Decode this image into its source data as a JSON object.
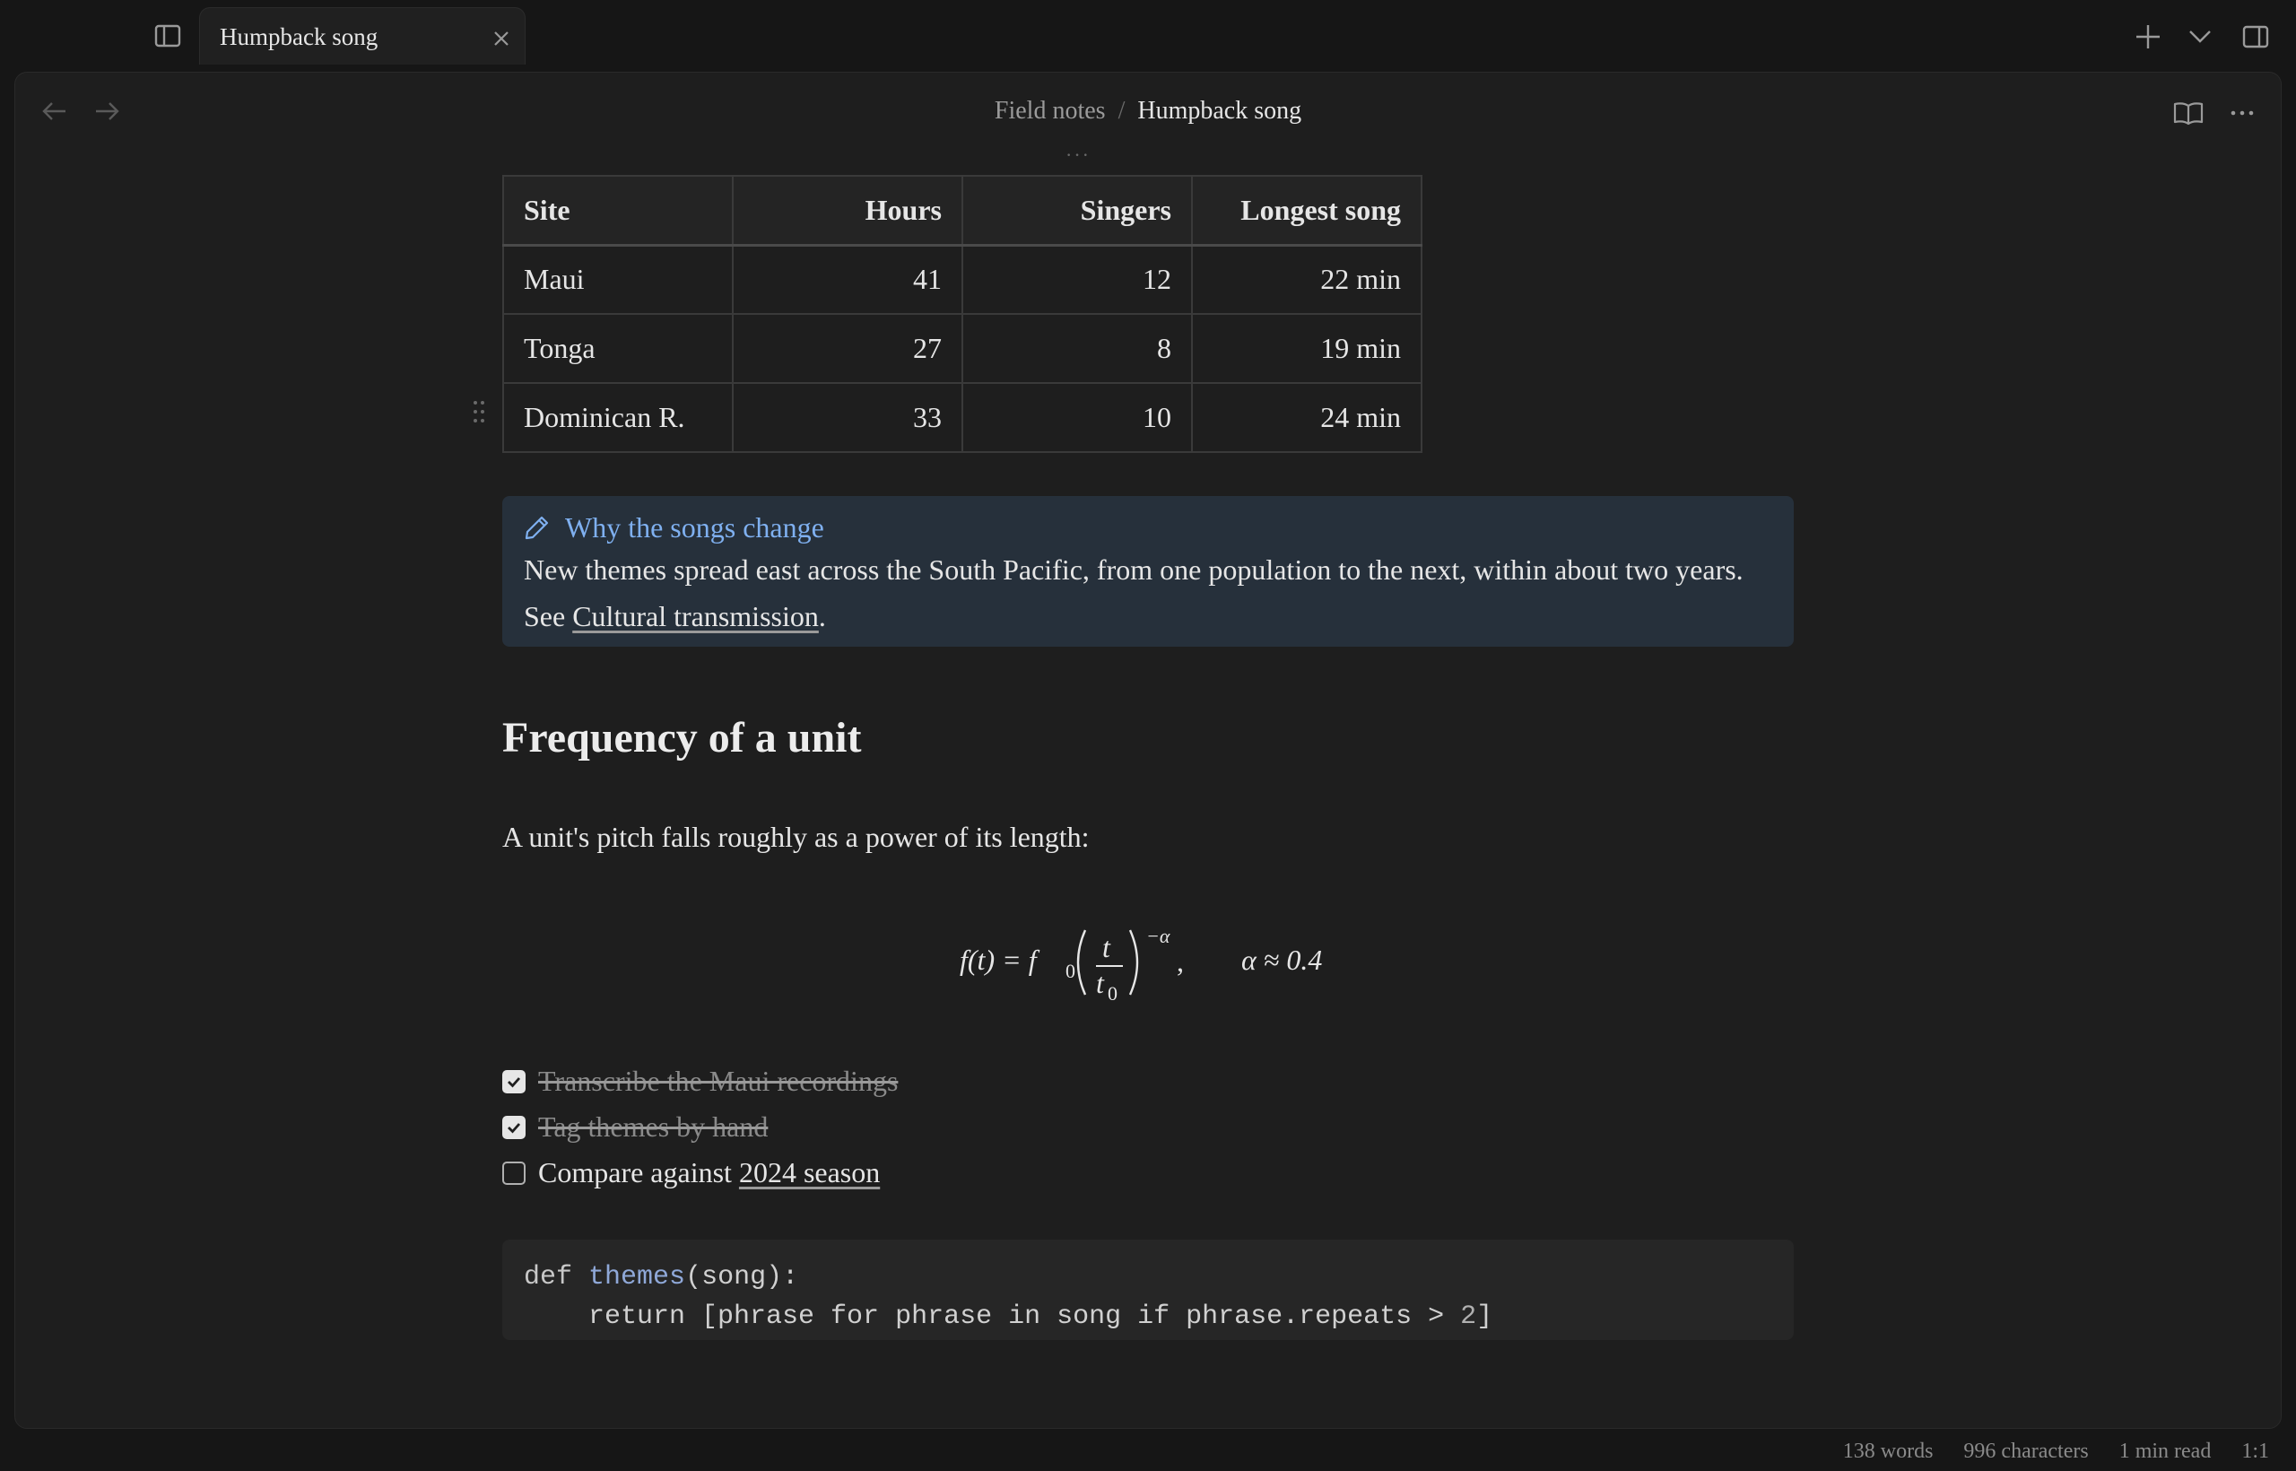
{
  "tab": {
    "title": "Humpback song"
  },
  "breadcrumb": {
    "parent": "Field notes",
    "separator": "/",
    "current": "Humpback song"
  },
  "table": {
    "headers": [
      "Site",
      "Hours",
      "Singers",
      "Longest song"
    ],
    "rows": [
      [
        "Maui",
        "41",
        "12",
        "22 min"
      ],
      [
        "Tonga",
        "27",
        "8",
        "19 min"
      ],
      [
        "Dominican R.",
        "33",
        "10",
        "24 min"
      ]
    ]
  },
  "callout": {
    "title": "Why the songs change",
    "body_before": "New themes spread east across the South Pacific, from one population to the next, within about two years. See ",
    "link": "Cultural transmission",
    "body_after": "."
  },
  "heading": "Frequency of a unit",
  "paragraph": "A unit's pitch falls roughly as a power of its length:",
  "equation": {
    "lhs": "f(t) = f",
    "sub0": "0",
    "num": "t",
    "den": "t",
    "exp": "−α",
    "comma": ",",
    "alpha": "α ≈ 0.4"
  },
  "tasks": [
    {
      "text": "Transcribe the Maui recordings",
      "done": true
    },
    {
      "text": "Tag themes by hand",
      "done": true
    },
    {
      "text_before": "Compare against ",
      "link": "2024 season",
      "done": false
    }
  ],
  "code": {
    "kw_def": "def",
    "fn_name": "themes",
    "sig_rest": "(song):",
    "line2_prefix": "    return [phrase for phrase in song if phrase.repeats > ",
    "line2_num": "2",
    "line2_suffix": "]"
  },
  "status": {
    "words": "138 words",
    "characters": "996 characters",
    "read_time": "1 min read",
    "cursor": "1:1"
  },
  "icons": {
    "sidebar_toggle": "sidebar-left-icon",
    "close": "close-icon",
    "new_tab": "plus-icon",
    "tab_list": "chevron-down-icon",
    "right_sidebar": "sidebar-right-icon",
    "back": "arrow-left-icon",
    "forward": "arrow-right-icon",
    "reading": "book-open-icon",
    "more": "more-horizontal-icon",
    "callout": "pencil-icon"
  },
  "colors": {
    "callout_accent": "#7fb0f0",
    "callout_bg": "#26303b",
    "bg": "#1e1e1e"
  }
}
